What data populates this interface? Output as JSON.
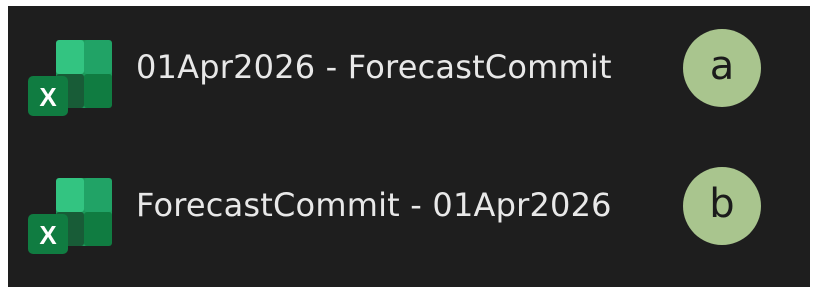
{
  "files": [
    {
      "name": "01Apr2026 - ForecastCommit",
      "icon": "excel-icon",
      "option_label": "a"
    },
    {
      "name": "ForecastCommit - 01Apr2026",
      "icon": "excel-icon",
      "option_label": "b"
    }
  ],
  "colors": {
    "background": "#1e1e1e",
    "text": "#e8e8e8",
    "badge": "#a9c58e",
    "excel_green": "#107c41"
  }
}
